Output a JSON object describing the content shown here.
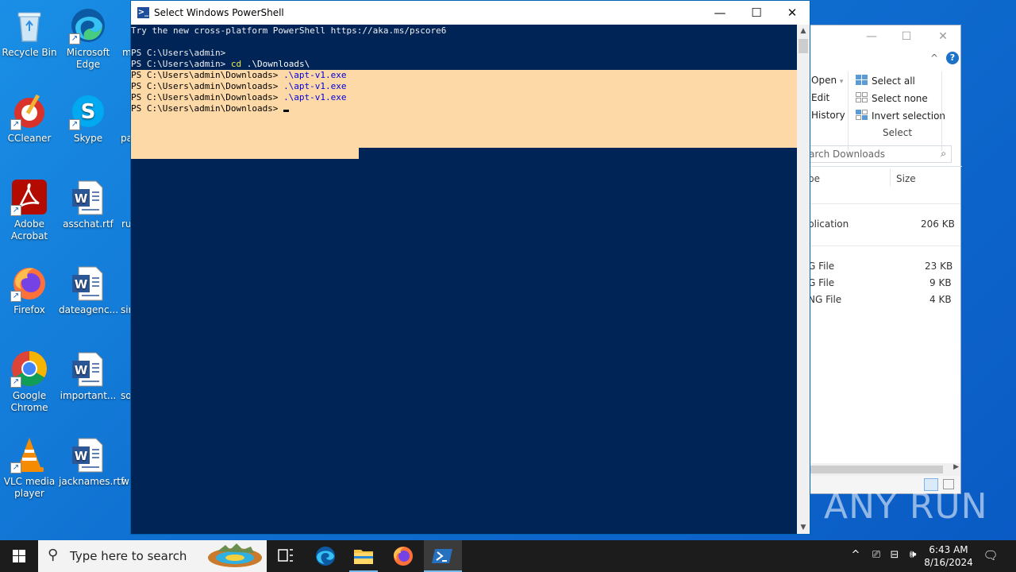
{
  "desktop": {
    "icons": [
      {
        "label": "Recycle Bin"
      },
      {
        "label": "Microsoft Edge"
      },
      {
        "label": "CCleaner"
      },
      {
        "label": "Skype"
      },
      {
        "label": "Adobe Acrobat"
      },
      {
        "label": "asschat.rtf"
      },
      {
        "label": "Firefox"
      },
      {
        "label": "dateagenc..."
      },
      {
        "label": "Google Chrome"
      },
      {
        "label": "important..."
      },
      {
        "label": "VLC media player"
      },
      {
        "label": "jacknames.rtf"
      }
    ],
    "partial_labels": [
      "m",
      "pa",
      "ru",
      "sir",
      "so",
      "w"
    ]
  },
  "powershell": {
    "title": "Select Windows PowerShell",
    "lines": {
      "banner": "Try the new cross-platform PowerShell https://aka.ms/pscore6",
      "prompt1": "PS C:\\Users\\admin>",
      "prompt2": "PS C:\\Users\\admin> ",
      "cmd_cd": "cd",
      "arg_cd": " .\\Downloads\\",
      "prompt_dl": "PS C:\\Users\\admin\\Downloads> ",
      "cmd_exe": ".\\apt-v1.exe",
      "prompt_last": "PS C:\\Users\\admin\\Downloads> "
    },
    "controls": {
      "minimize": "—",
      "maximize": "☐",
      "close": "✕"
    }
  },
  "explorer": {
    "controls": {
      "minimize": "—",
      "maximize": "☐",
      "close": "✕"
    },
    "ribbon": {
      "open": "Open",
      "edit": "Edit",
      "history": "History",
      "select_all": "Select all",
      "select_none": "Select none",
      "invert_selection": "Invert selection",
      "group_select": "Select"
    },
    "search_placeholder": "arch Downloads",
    "columns": {
      "type": "pe",
      "size": "Size"
    },
    "rows": [
      {
        "type": "plication",
        "size": "206 KB"
      },
      {
        "type": "G File",
        "size": "23 KB"
      },
      {
        "type": "G File",
        "size": "9 KB"
      },
      {
        "type": "NG File",
        "size": "4 KB"
      }
    ]
  },
  "watermark": "ANY RUN",
  "taskbar": {
    "search_placeholder": "Type here to search",
    "time": "6:43 AM",
    "date": "8/16/2024"
  },
  "colors": {
    "console_bg": "#012456",
    "selection": "#fdd9a7",
    "taskbar": "#1c1c1c",
    "accent": "#0078d7"
  }
}
